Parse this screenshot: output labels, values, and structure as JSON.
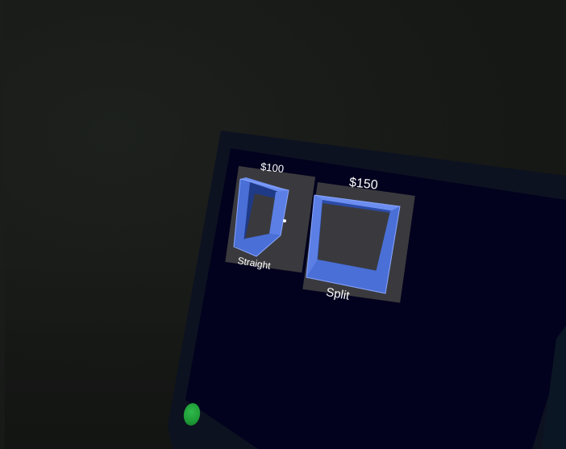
{
  "shop": {
    "items": [
      {
        "name": "Straight",
        "price": "$100",
        "model_icon": "straight-wall-frame-icon"
      },
      {
        "name": "Split",
        "price": "$150",
        "model_icon": "split-wall-frame-icon"
      }
    ],
    "power_button": {
      "icon": "green-power-button-icon"
    }
  },
  "colors": {
    "background": "#181a18",
    "bezel": "#0d1220",
    "screen": "#02021e",
    "card": "#3a3a3e",
    "model_blue": "#4a6fd6",
    "model_blue_dark": "#2c4ca8",
    "text": "#ffffff",
    "power_green": "#22a63c"
  }
}
